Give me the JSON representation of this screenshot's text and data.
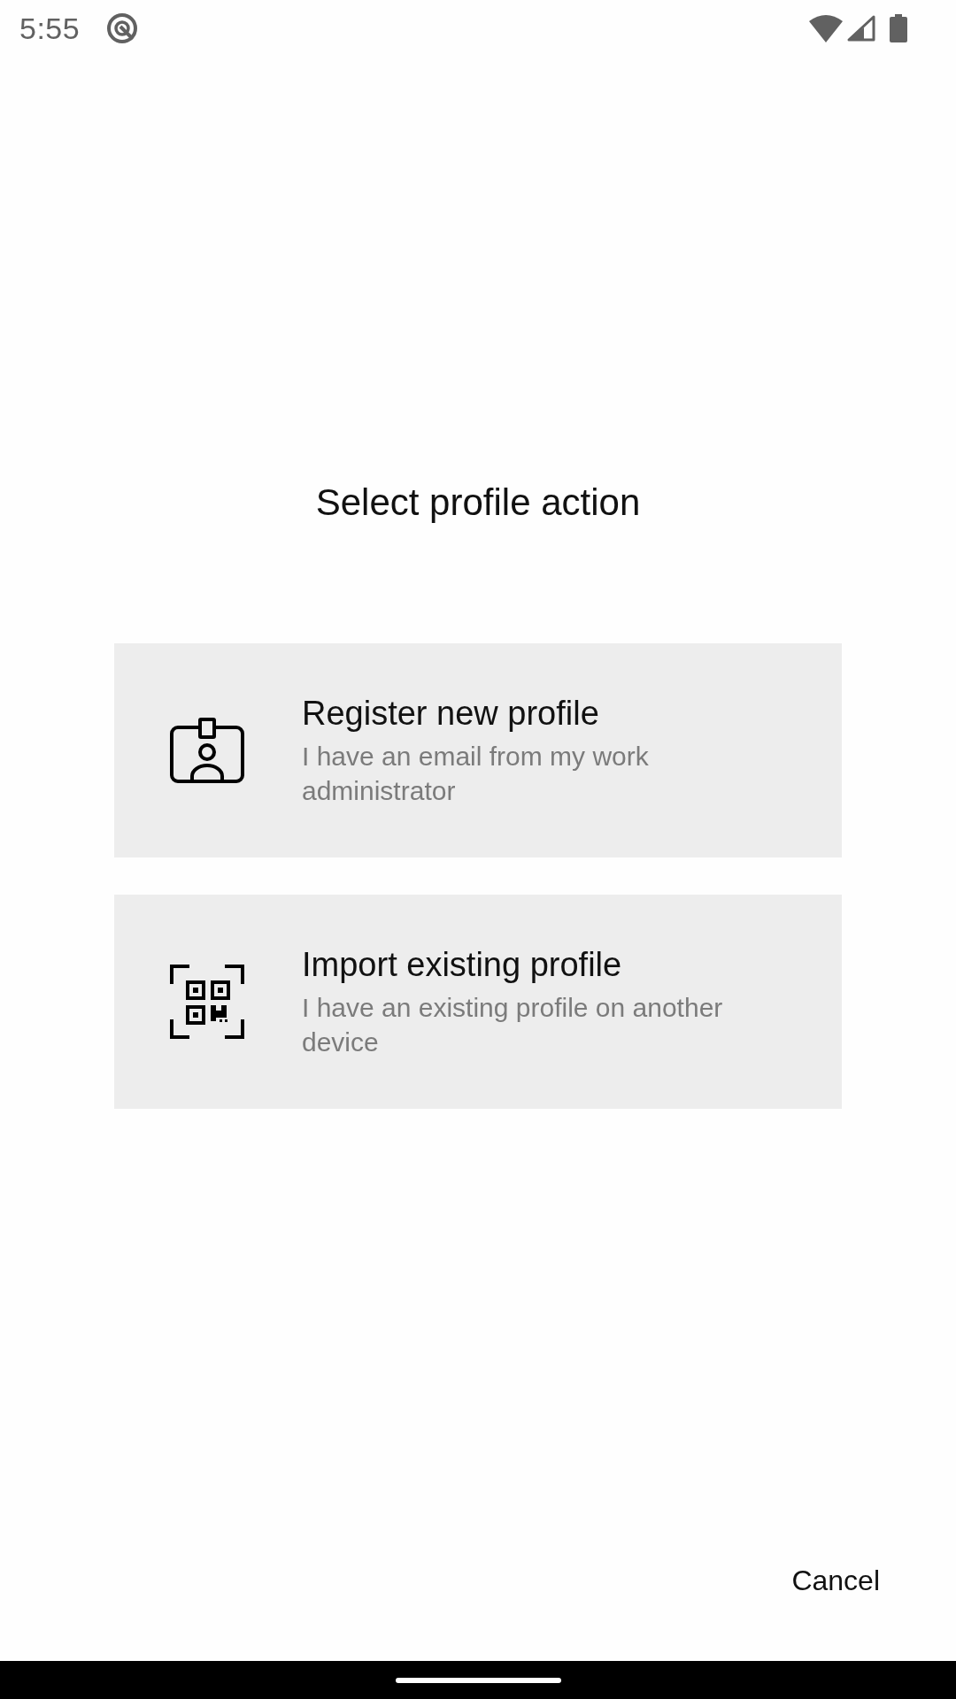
{
  "status_bar": {
    "time": "5:55"
  },
  "dialog": {
    "title": "Select profile action",
    "options": [
      {
        "kind": "register",
        "title": "Register new profile",
        "subtitle": "I have an email from my work administrator"
      },
      {
        "kind": "import",
        "title": "Import existing profile",
        "subtitle": "I have an existing profile on another device"
      }
    ],
    "buttons": [
      "Cancel"
    ]
  }
}
